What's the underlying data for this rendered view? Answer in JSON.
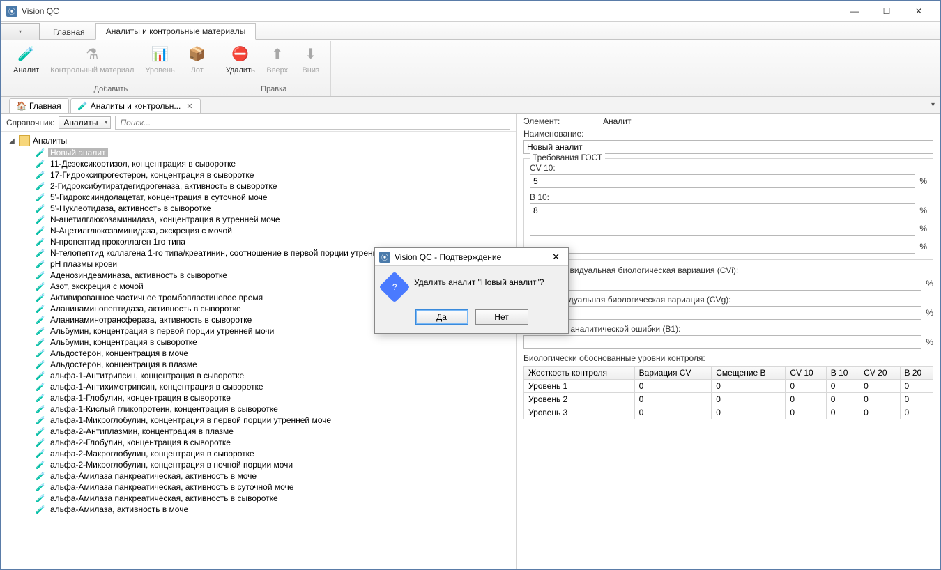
{
  "window": {
    "title": "Vision QC"
  },
  "ribbon": {
    "tabs": [
      {
        "label": "Главная"
      },
      {
        "label": "Аналиты и контрольные материалы"
      }
    ],
    "groups": {
      "add": {
        "name": "Добавить",
        "analyte": "Аналит",
        "control": "Контрольный материал",
        "level": "Уровень",
        "lot": "Лот"
      },
      "edit": {
        "name": "Правка",
        "delete": "Удалить",
        "up": "Вверх",
        "down": "Вниз"
      }
    }
  },
  "doctabs": [
    {
      "label": "Главная"
    },
    {
      "label": "Аналиты и контрольн..."
    }
  ],
  "filter": {
    "label": "Справочник:",
    "combo": "Аналиты",
    "placeholder": "Поиск..."
  },
  "tree": {
    "root": "Аналиты",
    "selected": "Новый аналит",
    "items": [
      "11-Дезоксикортизол, концентрация в сыворотке",
      "17-Гидроксипрогестерон, концентрация в сыворотке",
      "2-Гидроксибутиратдегидрогеназа, активность в сыворотке",
      "5'-Гидроксииндолацетат, концентрация в суточной моче",
      "5'-Нуклеотидаза, активность в сыворотке",
      "N-ацетилглюкозаминидаза, концентрация в утренней моче",
      "N-Ацетилглюкозаминидаза, экскреция с мочой",
      "N-пропептид проколлаген 1го типа",
      "N-телопептид коллагена 1-го  типа/креатинин, соотношение в первой порции утренней мочи",
      "pH плазмы крови",
      "Аденозиндеаминаза, активность в сыворотке",
      "Азот, экскреция с мочой",
      "Активированное частичное тромбопластиновое время",
      "Аланинаминопептидаза, активность в сыворотке",
      "Аланинаминотрансфераза, активность в сыворотке",
      "Альбумин, концентрация в первой порции утренней мочи",
      "Альбумин, концентрация в сыворотке",
      "Альдостерон, концентрация в моче",
      "Альдостерон, концентрация в плазме",
      "альфа-1-Антитрипсин, концентрация в сыворотке",
      "альфа-1-Антихимотрипсин, концентрация в сыворотке",
      "альфа-1-Глобулин, концентрация в сыворотке",
      "альфа-1-Кислый гликопротеин, концентрация в сыворотке",
      "альфа-1-Микроглобулин, концентрация в первой порции утренней моче",
      "альфа-2-Антиплазмин, концентрация в плазме",
      "альфа-2-Глобулин, концентрация в сыворотке",
      "альфа-2-Макроглобулин, концентрация в сыворотке",
      "альфа-2-Микроглобулин, концентрация в ночной порции мочи",
      "альфа-Амилаза панкреатическая, активность в моче",
      "альфа-Амилаза панкреатическая, активность в суточной моче",
      "альфа-Амилаза панкреатическая, активность в сыворотке",
      "альфа-Амилаза, активность в моче"
    ]
  },
  "props": {
    "element_label": "Элемент:",
    "element_value": "Аналит",
    "name_label": "Наименование:",
    "name_value": "Новый аналит",
    "gost_legend": "Требования ГОСТ",
    "cv10_label": "CV 10:",
    "cv10_value": "5",
    "b10_label": "B 10:",
    "b10_value": "8",
    "cvi_label": "Внутрииндивидуальная биологическая вариация (CVi):",
    "cvg_label": "Межиндивидуальная биологическая вариация (CVg):",
    "b1_label": "ПДЗ общей аналитической ошибки (B1):",
    "bio_levels_label": "Биологически обоснованные уровни контроля:",
    "pct": "%",
    "table": {
      "headers": [
        "Жесткость контроля",
        "Вариация CV",
        "Смещение B",
        "CV 10",
        "B 10",
        "CV 20",
        "B 20"
      ],
      "rows": [
        [
          "Уровень 1",
          "0",
          "0",
          "0",
          "0",
          "0",
          "0"
        ],
        [
          "Уровень 2",
          "0",
          "0",
          "0",
          "0",
          "0",
          "0"
        ],
        [
          "Уровень 3",
          "0",
          "0",
          "0",
          "0",
          "0",
          "0"
        ]
      ]
    }
  },
  "dialog": {
    "title": "Vision QC - Подтверждение",
    "message": "Удалить аналит \"Новый аналит\"?",
    "yes": "Да",
    "no": "Нет"
  }
}
